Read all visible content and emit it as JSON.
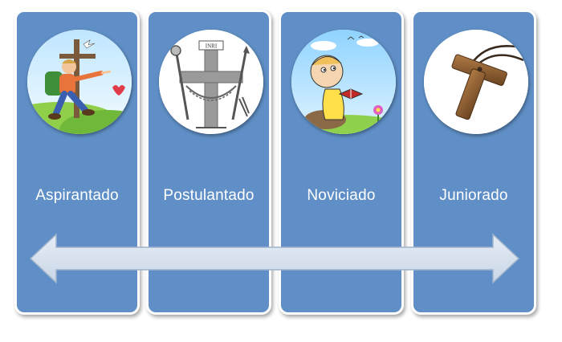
{
  "stages": [
    {
      "label": "Aspirantado",
      "icon": "hiker-with-cross-icon"
    },
    {
      "label": "Postulantado",
      "icon": "cross-emblem-icon"
    },
    {
      "label": "Noviciado",
      "icon": "child-reading-icon"
    },
    {
      "label": "Juniorado",
      "icon": "tau-cross-pendant-icon"
    }
  ],
  "emblem": {
    "inscription": "INRI"
  },
  "colors": {
    "card": "#5f8fc6",
    "arrow": "#d7e1ee",
    "text": "#ffffff"
  }
}
